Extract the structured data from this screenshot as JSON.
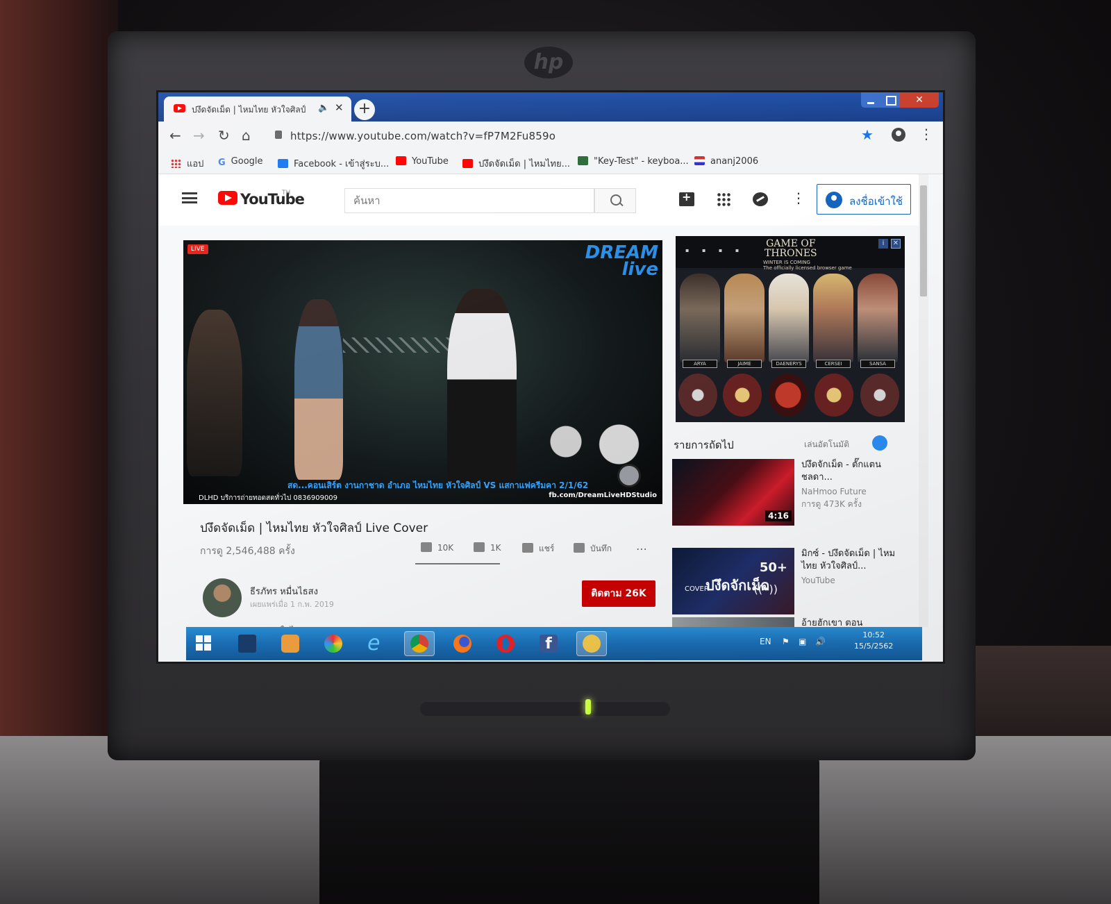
{
  "colors": {
    "youtube_red": "#ff0000",
    "chrome_blue": "#1a3f8a",
    "accent_blue": "#1565c0",
    "subscribe_red": "#cc0000",
    "taskbar_blue": "#1b6fb7"
  },
  "browser": {
    "tab_title": "ปงึดจัดเม็ด | ไหมไทย หัวใจศิลป์",
    "new_tab_label": "+",
    "window_close_label": "✕",
    "url": "https://www.youtube.com/watch?v=fP7M2Fu859o",
    "back_label": "←",
    "forward_label": "→",
    "reload_label": "↻",
    "home_label": "⌂",
    "star_label": "★",
    "menu_label": "⋮",
    "bookmarks": [
      {
        "label": "แอป",
        "icon": "apps-grid-icon"
      },
      {
        "label": "Google",
        "icon": "google-icon"
      },
      {
        "label": "Facebook - เข้าสู่ระบ...",
        "icon": "facebook-icon"
      },
      {
        "label": "YouTube",
        "icon": "youtube-icon"
      },
      {
        "label": "ปงึดจัดเม็ด | ไหมไทย...",
        "icon": "youtube-icon"
      },
      {
        "label": "\"Key-Test\" - keyboa...",
        "icon": "k-icon"
      },
      {
        "label": "ananj2006",
        "icon": "flag-icon"
      }
    ]
  },
  "youtube": {
    "logo_text": "YouTube",
    "logo_tm": "TH",
    "search_placeholder": "ค้นหา",
    "more_label": "⋮",
    "sign_in_label": "ลงชื่อเข้าใช้",
    "video": {
      "live_badge": "LIVE",
      "brand_line1": "DREAM",
      "brand_line2": "live",
      "caption": "สด...คอนเสิร์ต งานกาชาด อำเภอ ไหมไทย หัวใจศิลป์ VS แสกาแฟครีมคา 2/1/62",
      "bottom_left": "DLHD บริการถ่ายทอดสดทั่วไป 0836909009",
      "bottom_right": "fb.com/DreamLiveHDStudio",
      "title": "ปงึดจัดเม็ด | ไหมไทย หัวใจศิลป์ Live Cover",
      "views": "การดู 2,546,488 ครั้ง",
      "likes": "10K",
      "dislikes": "1K",
      "share_label": "แชร์",
      "save_label": "บันทึก",
      "more_label": "⋯"
    },
    "channel": {
      "name": "ธีรภัทร หมื่นไธสง",
      "published": "เผยแพร่เมื่อ 1 ก.พ. 2019",
      "subscribe_label": "ติดตาม 26K",
      "description": "แสดงสดในไทย งานกาชาดสารคาม"
    },
    "ad": {
      "title_line1": "GAME OF",
      "title_line2": "THRONES",
      "tagline": "WINTER IS COMING",
      "subtitle": "The officially licensed browser game",
      "info_label": "i",
      "close_label": "✕",
      "heroes": [
        "ARYA",
        "JAIME",
        "DAENERYS",
        "CERSEI",
        "SANSA"
      ]
    },
    "sidebar": {
      "up_next_label": "รายการถัดไป",
      "autoplay_label": "เล่นอัตโนมัติ",
      "recommendations": [
        {
          "title": "ปงึดจักเม็ด - ตั๊กแตน ชลดา...",
          "channel": "NaHmoo Future",
          "views": "การดู 473K ครั้ง",
          "duration": "4:16",
          "thumb_text": ""
        },
        {
          "title": "มิกซ์ - ปงึดจัดเม็ด | ไหมไทย หัวใจศิลป์...",
          "channel": "YouTube",
          "views": "",
          "duration": "",
          "thumb_text": "50+",
          "thumb_word": "ปงึดจักเม็ด",
          "thumb_small": "COVER"
        },
        {
          "title": "อ้ายฮักเขา ตอน",
          "channel": "",
          "views": "",
          "duration": "",
          "thumb_text": ""
        }
      ]
    }
  },
  "taskbar": {
    "lang": "EN",
    "time": "10:52",
    "date": "15/5/2562",
    "items": [
      "start",
      "explorer",
      "media-player",
      "paint",
      "internet-explorer",
      "chrome",
      "firefox",
      "opera",
      "facebook",
      "messenger"
    ]
  },
  "monitor": {
    "brand": "hp"
  }
}
